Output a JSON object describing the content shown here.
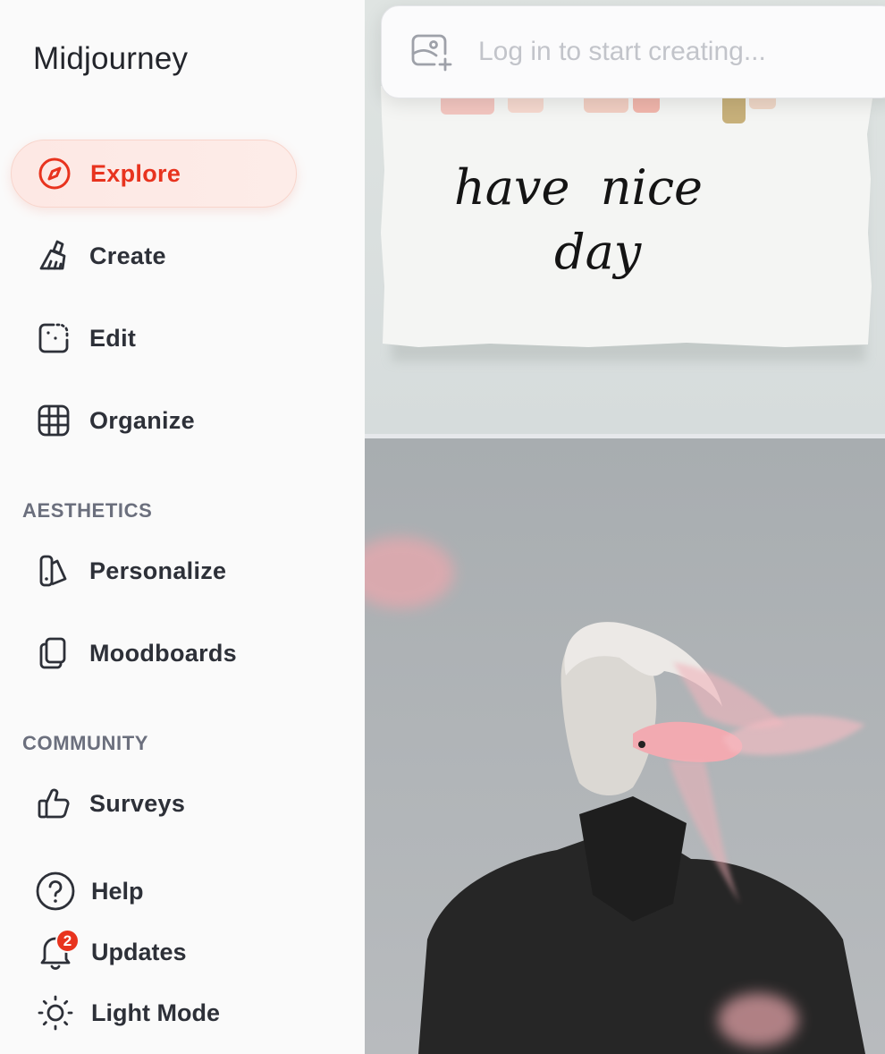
{
  "app": {
    "title": "Midjourney"
  },
  "nav": {
    "explore": {
      "label": "Explore",
      "icon": "compass-icon"
    },
    "create": {
      "label": "Create",
      "icon": "brush-icon"
    },
    "edit": {
      "label": "Edit",
      "icon": "edit-dashed-icon"
    },
    "organize": {
      "label": "Organize",
      "icon": "grid-icon"
    }
  },
  "sections": {
    "aesthetics": "AESTHETICS",
    "community": "COMMUNITY"
  },
  "aesthetics": {
    "personalize": {
      "label": "Personalize",
      "icon": "swatch-icon"
    },
    "moodboards": {
      "label": "Moodboards",
      "icon": "cards-icon"
    }
  },
  "community": {
    "surveys": {
      "label": "Surveys",
      "icon": "thumbs-up-icon"
    }
  },
  "footer": {
    "help": {
      "label": "Help",
      "icon": "question-icon"
    },
    "updates": {
      "label": "Updates",
      "icon": "bell-icon",
      "badge": "2"
    },
    "light_mode": {
      "label": "Light Mode",
      "icon": "sun-icon"
    }
  },
  "search": {
    "placeholder": "Log in to start creating...",
    "icon": "image-add-icon"
  },
  "feed": {
    "image1_text": [
      "have  nice",
      "day"
    ]
  },
  "colors": {
    "accent": "#e8331e",
    "text": "#2d3038",
    "section": "#6b6f7d",
    "placeholder": "#c2c4ca"
  }
}
